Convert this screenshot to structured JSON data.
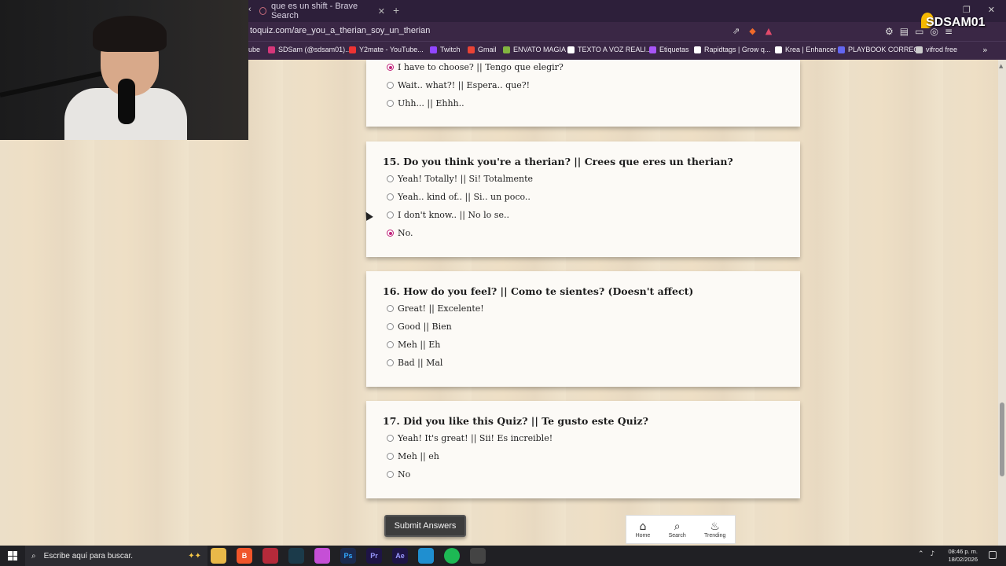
{
  "browser": {
    "tab_title": "que es un shift - Brave Search",
    "url": "toquiz.com/are_you_a_therian_soy_un_therian",
    "bookmarks": [
      {
        "label": "ube",
        "color": "#e33"
      },
      {
        "label": "SDSam (@sdsam01)...",
        "color": "#d6377a"
      },
      {
        "label": "Y2mate - YouTube...",
        "color": "#e33"
      },
      {
        "label": "Twitch",
        "color": "#9146ff"
      },
      {
        "label": "Gmail",
        "color": "#ea4335"
      },
      {
        "label": "ENVATO MAGIA",
        "color": "#82b540"
      },
      {
        "label": "TEXTO A VOZ REALI...",
        "color": "#ffffff"
      },
      {
        "label": "Etiquetas",
        "color": "#a855f7"
      },
      {
        "label": "Rapidtags | Grow q...",
        "color": "#ffffff"
      },
      {
        "label": "Krea | Enhancer",
        "color": "#ffffff"
      },
      {
        "label": "PLAYBOOK CORREO",
        "color": "#6366f1"
      },
      {
        "label": "vifrod free",
        "color": "#cccccc"
      }
    ]
  },
  "logo_text": "SDSAM01",
  "quiz": {
    "prev_options": [
      {
        "label": "I have to choose? || Tengo que elegir?",
        "selected": true
      },
      {
        "label": "Wait.. what?! || Espera.. que?!",
        "selected": false
      },
      {
        "label": "Uhh... || Ehhh..",
        "selected": false
      }
    ],
    "q15": {
      "title": "15. Do you think you're a therian? || Crees que eres un therian?",
      "options": [
        {
          "label": "Yeah! Totally! || Si! Totalmente",
          "selected": false
        },
        {
          "label": "Yeah.. kind of.. || Si.. un poco..",
          "selected": false
        },
        {
          "label": "I don't know.. || No lo se..",
          "selected": false
        },
        {
          "label": "No.",
          "selected": true
        }
      ]
    },
    "q16": {
      "title": "16. How do you feel? || Como te sientes? (Doesn't affect)",
      "options": [
        {
          "label": "Great! || Excelente!",
          "selected": false
        },
        {
          "label": "Good || Bien",
          "selected": false
        },
        {
          "label": "Meh || Eh",
          "selected": false
        },
        {
          "label": "Bad || Mal",
          "selected": false
        }
      ]
    },
    "q17": {
      "title": "17. Did you like this Quiz? || Te gusto este Quiz?",
      "options": [
        {
          "label": "Yeah! It's great! || Sii! Es increible!",
          "selected": false
        },
        {
          "label": "Meh || eh",
          "selected": false
        },
        {
          "label": "No",
          "selected": false
        }
      ]
    },
    "submit_label": "Submit Answers"
  },
  "bottom_nav": {
    "home": "Home",
    "search": "Search",
    "trending": "Trending"
  },
  "taskbar": {
    "search_placeholder": "Escribe aquí para buscar.",
    "time": "08:46 p. m.",
    "date": "18/02/2026"
  }
}
